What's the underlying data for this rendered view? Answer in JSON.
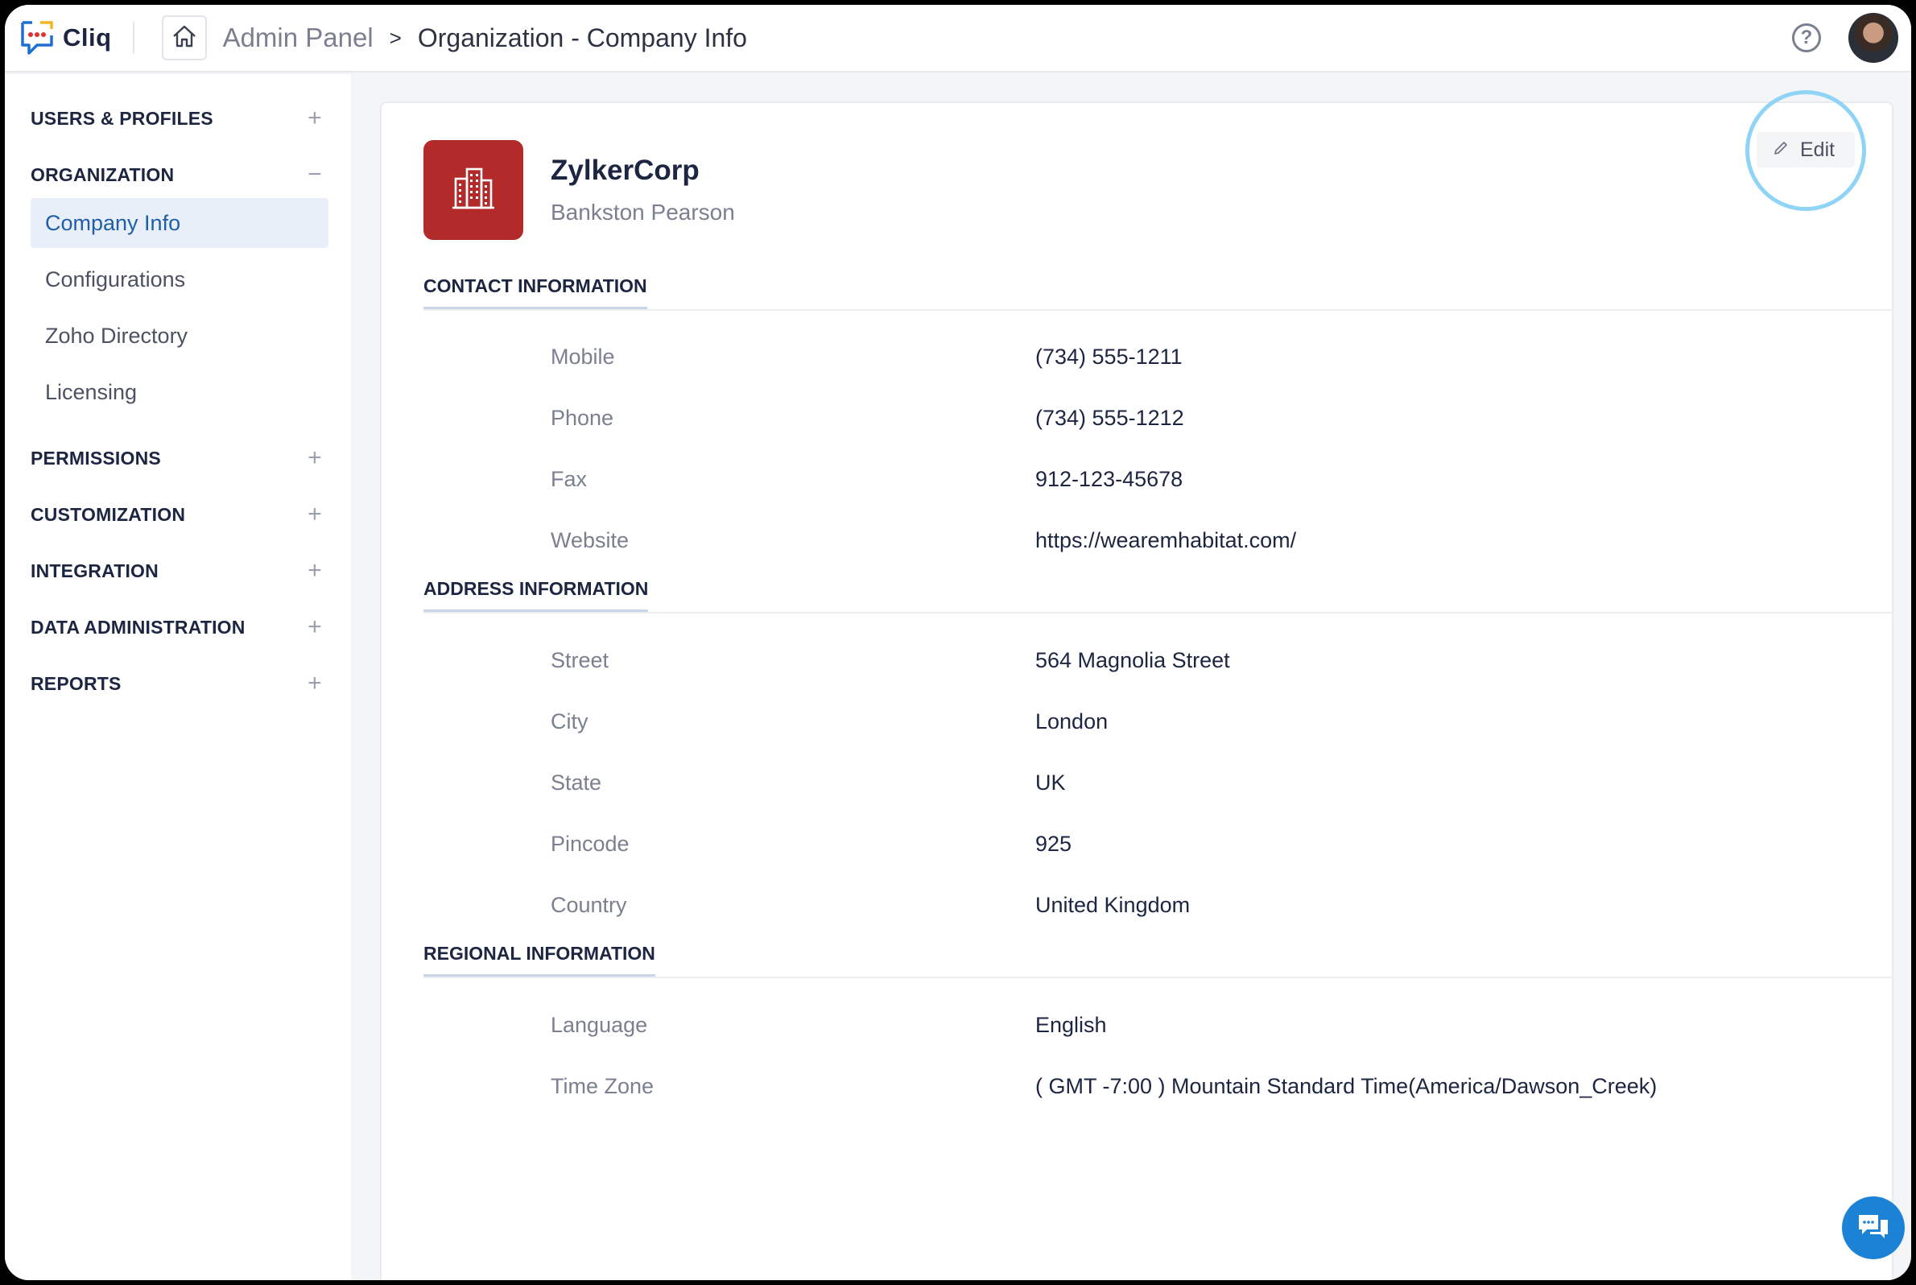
{
  "app": {
    "name": "Cliq"
  },
  "breadcrumb": {
    "root": "Admin Panel",
    "separator": ">",
    "current": "Organization - Company Info"
  },
  "icons": {
    "logo": "cliq-logo-icon",
    "home": "home-icon",
    "help": "help-icon",
    "chat": "chat-icon",
    "edit": "pencil-icon",
    "org": "building-icon"
  },
  "colors": {
    "accent": "#1f5fa8",
    "org_logo_bg": "#b22a2a",
    "chat": "#1b82d6",
    "highlight_ring": "#8fd3f7"
  },
  "sidebar": {
    "sections": [
      {
        "label": "USERS & PROFILES",
        "toggle": "+"
      },
      {
        "label": "ORGANIZATION",
        "toggle": "−"
      },
      {
        "label": "PERMISSIONS",
        "toggle": "+"
      },
      {
        "label": "CUSTOMIZATION",
        "toggle": "+"
      },
      {
        "label": "INTEGRATION",
        "toggle": "+"
      },
      {
        "label": "DATA ADMINISTRATION",
        "toggle": "+"
      },
      {
        "label": "REPORTS",
        "toggle": "+"
      }
    ],
    "organization_items": [
      {
        "label": "Company Info",
        "active": true
      },
      {
        "label": "Configurations",
        "active": false
      },
      {
        "label": "Zoho Directory",
        "active": false
      },
      {
        "label": "Licensing",
        "active": false
      }
    ]
  },
  "company": {
    "name": "ZylkerCorp",
    "owner": "Bankston Pearson",
    "edit_label": "Edit"
  },
  "contact": {
    "title": "CONTACT INFORMATION",
    "fields": [
      {
        "label": "Mobile",
        "value": "(734) 555-1211"
      },
      {
        "label": "Phone",
        "value": "(734) 555-1212"
      },
      {
        "label": "Fax",
        "value": "912-123-45678"
      },
      {
        "label": "Website",
        "value": "https://wearemhabitat.com/"
      }
    ]
  },
  "address": {
    "title": "ADDRESS INFORMATION",
    "fields": [
      {
        "label": "Street",
        "value": "564 Magnolia Street"
      },
      {
        "label": "City",
        "value": "London"
      },
      {
        "label": "State",
        "value": "UK"
      },
      {
        "label": "Pincode",
        "value": "925"
      },
      {
        "label": "Country",
        "value": "United Kingdom"
      }
    ]
  },
  "regional": {
    "title": "REGIONAL INFORMATION",
    "fields": [
      {
        "label": "Language",
        "value": "English"
      },
      {
        "label": "Time Zone",
        "value": "( GMT -7:00 ) Mountain Standard Time(America/Dawson_Creek)"
      }
    ]
  }
}
